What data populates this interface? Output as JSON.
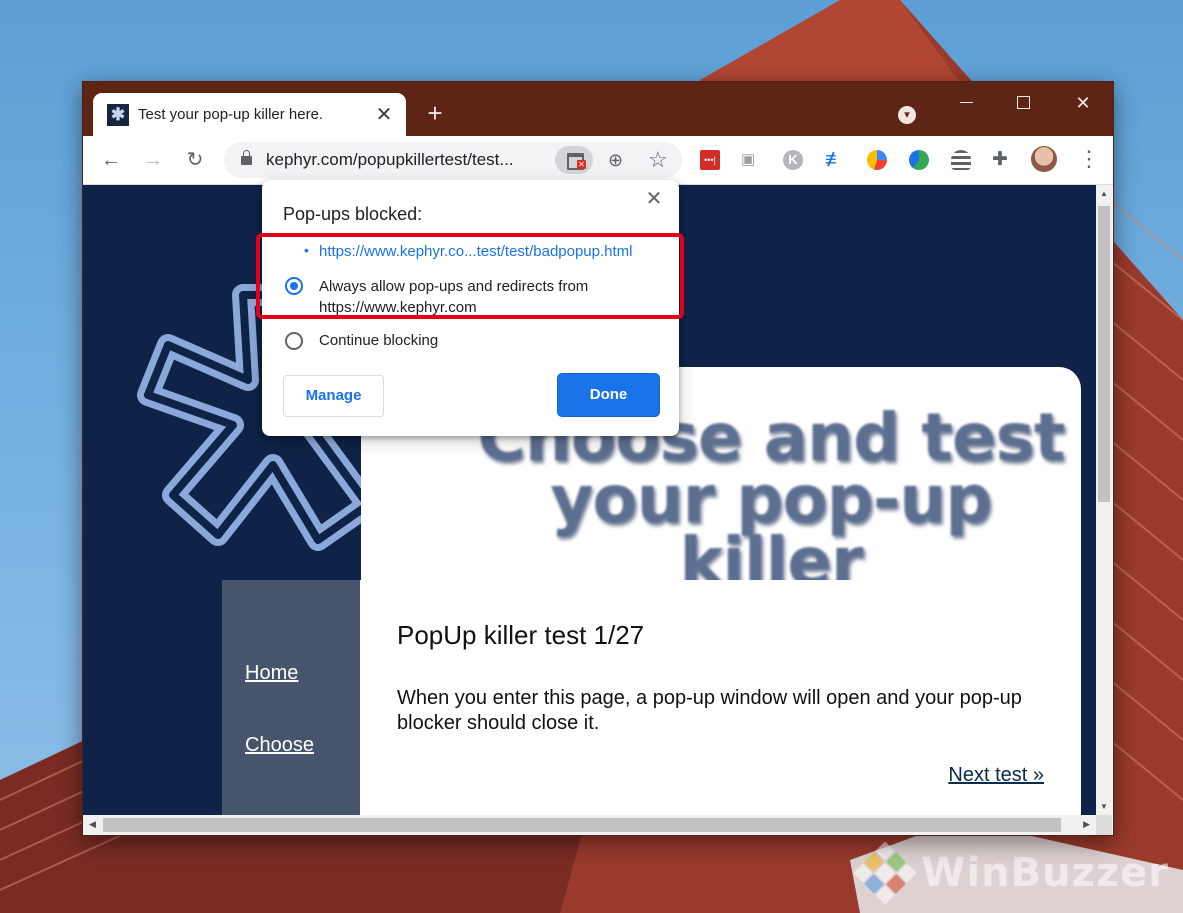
{
  "browser": {
    "tab": {
      "title": "Test your pop-up killer here."
    },
    "address_bar": {
      "url": "kephyr.com/popupkillertest/test..."
    }
  },
  "popup_bubble": {
    "title": "Pop-ups blocked:",
    "blocked_link": "https://www.kephyr.co...test/test/badpopup.html",
    "options": [
      {
        "label": "Always allow pop-ups and redirects from https://www.kephyr.com",
        "selected": true
      },
      {
        "label": "Continue blocking",
        "selected": false
      }
    ],
    "manage_label": "Manage",
    "done_label": "Done"
  },
  "page": {
    "header_text": "Choose and test your pop-up killer",
    "nav": [
      "Home",
      "Choose"
    ],
    "heading": "PopUp killer test 1/27",
    "body": "When you enter this page, a pop-up window will open and your pop-up blocker should close it.",
    "next_link": "Next test »"
  },
  "watermark": "WinBuzzer",
  "colors": {
    "titlebar": "#5e2517",
    "accent": "#1a73e8",
    "highlight": "#e4001a",
    "page_background": "#0e2347"
  },
  "icons": {
    "toolbar": [
      "back-icon",
      "forward-icon",
      "reload-icon",
      "lock-icon",
      "popup-blocked-icon",
      "zoom-icon",
      "bookmark-star-icon",
      "extensions-icon",
      "menu-icon"
    ]
  }
}
